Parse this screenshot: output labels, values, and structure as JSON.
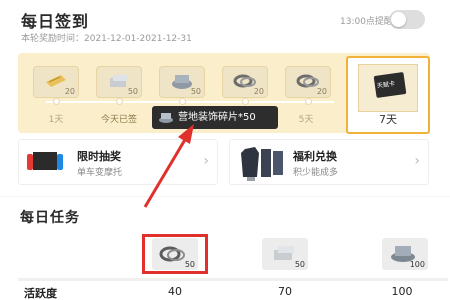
{
  "signin": {
    "title": "每日签到",
    "period": "本轮奖励时间：2021-12-01-2021-12-31",
    "reminder_label": "13:00点提醒",
    "rewards": [
      {
        "count": "20",
        "icon": "ticket-icon"
      },
      {
        "count": "50",
        "icon": "coin-stack-icon"
      },
      {
        "count": "50",
        "icon": "material-pile-icon"
      },
      {
        "count": "20",
        "icon": "ring-icon"
      },
      {
        "count": "20",
        "icon": "ring-icon"
      }
    ],
    "days": [
      "1天",
      "今天已签",
      "",
      "",
      "5天"
    ],
    "day7_label": "7天",
    "day7_item_text": "天赋卡"
  },
  "tooltip": {
    "text": "营地装饰碎片*50"
  },
  "promos": {
    "lottery": {
      "title": "限时抽奖",
      "subtitle": "单车变摩托"
    },
    "exchange": {
      "title": "福利兑换",
      "subtitle": "积少能成多"
    }
  },
  "tasks": {
    "title": "每日任务",
    "rewards": [
      {
        "count": "50"
      },
      {
        "count": "50"
      },
      {
        "count": "100"
      }
    ],
    "activity_label": "活跃度",
    "milestones": [
      "40",
      "70",
      "100"
    ]
  },
  "colors": {
    "accent_gold": "#f0b23a",
    "panel_cream": "#fbeecb",
    "annotation_red": "#e0302c"
  }
}
